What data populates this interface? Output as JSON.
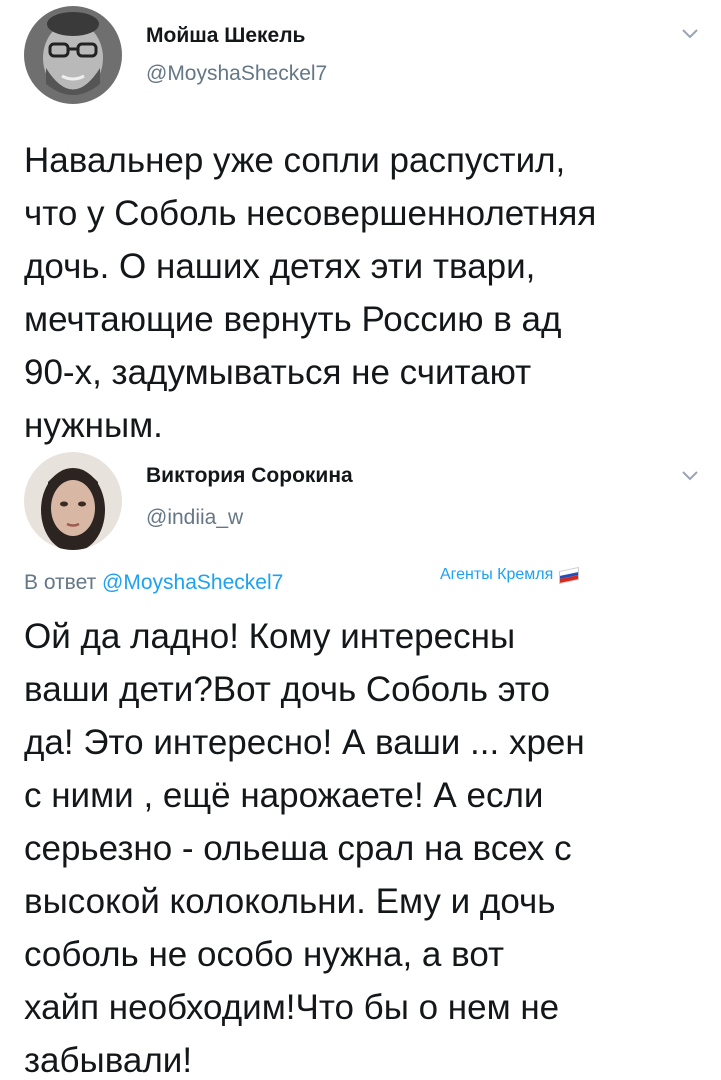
{
  "tweet1": {
    "author_name": "Мойша Шекель",
    "author_handle": "@MoyshaSheckel7",
    "text_lines": [
      "Навальнер уже сопли распустил,",
      "что у Соболь несовершеннолетняя",
      "дочь. О наших детях эти твари,",
      "мечтающие вернуть Россию в ад",
      "90-х, задумываться не считают",
      "нужным."
    ]
  },
  "tweet2": {
    "author_name": "Виктория Сорокина",
    "author_handle": "@indiia_w",
    "reply_prefix": "В ответ",
    "reply_to": "@MoyshaSheckel7",
    "label": "Агенты Кремля",
    "text_lines": [
      "Ой да ладно! Кому интересны",
      "ваши дети?Вот дочь Соболь это",
      "да! Это интересно! А ваши ... хрен",
      "с ними , ещё нарожаете!  А если",
      "серьезно - ольеша срал на всех с",
      "высокой колокольни. Ему и дочь",
      "соболь не особо нужна, а вот",
      "хайп необходим!Что бы о нем не",
      "забывали!"
    ]
  },
  "colors": {
    "text": "#14171a",
    "secondary": "#657786",
    "link": "#1da1f2",
    "flag_white": "#ffffff",
    "flag_blue": "#1f4fbf",
    "flag_red": "#d52b1e"
  },
  "icons": {
    "menu": "chevron-down-icon",
    "flag": "russia-flag-icon"
  }
}
